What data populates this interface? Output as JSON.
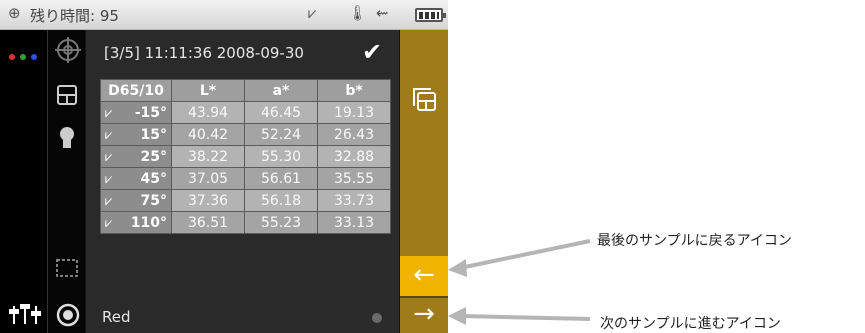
{
  "status_bar": {
    "remaining_label": "残り時間: 95",
    "icons": [
      "target-icon",
      "angle-icon",
      "thermometer-icon",
      "usb-icon",
      "battery-icon"
    ]
  },
  "header": {
    "measurement_info": "[3/5] 11:11:36 2008-09-30"
  },
  "table": {
    "columns": [
      "D65/10",
      "L*",
      "a*",
      "b*"
    ],
    "rows": [
      {
        "angle": "-15°",
        "L": "43.94",
        "a": "46.45",
        "b": "19.13"
      },
      {
        "angle": "15°",
        "L": "40.42",
        "a": "52.24",
        "b": "26.43"
      },
      {
        "angle": "25°",
        "L": "38.22",
        "a": "55.30",
        "b": "32.88"
      },
      {
        "angle": "45°",
        "L": "37.05",
        "a": "56.61",
        "b": "35.55"
      },
      {
        "angle": "75°",
        "L": "37.36",
        "a": "56.18",
        "b": "33.73"
      },
      {
        "angle": "110°",
        "L": "36.51",
        "a": "55.23",
        "b": "33.13"
      }
    ]
  },
  "sample": {
    "name": "Red"
  },
  "callouts": {
    "prev": "最後のサンプルに戻るアイコン",
    "next": "次のサンプルに進むアイコン"
  },
  "colors": {
    "accent_gold": "#a07b19",
    "active_button": "#f0b400",
    "dots": [
      "#e03030",
      "#30a030",
      "#3050e0"
    ]
  }
}
